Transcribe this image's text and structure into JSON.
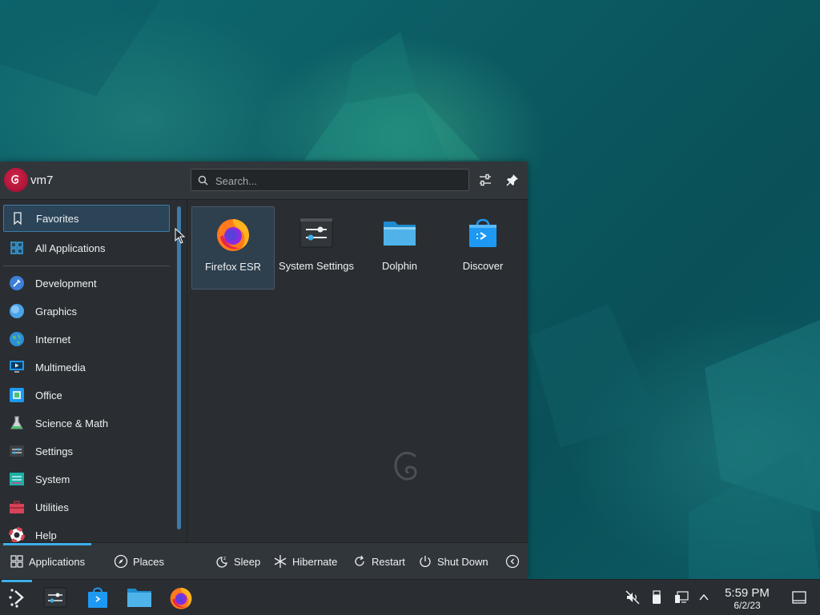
{
  "user": {
    "name": "vm7"
  },
  "search": {
    "placeholder": "Search..."
  },
  "sidebar": {
    "items": [
      {
        "label": "Favorites",
        "icon": "bookmark-icon"
      },
      {
        "label": "All Applications",
        "icon": "grid-icon"
      },
      {
        "label": "Development",
        "icon": "development-icon"
      },
      {
        "label": "Graphics",
        "icon": "graphics-icon"
      },
      {
        "label": "Internet",
        "icon": "globe-icon"
      },
      {
        "label": "Multimedia",
        "icon": "multimedia-icon"
      },
      {
        "label": "Office",
        "icon": "office-icon"
      },
      {
        "label": "Science & Math",
        "icon": "flask-icon"
      },
      {
        "label": "Settings",
        "icon": "settings-icon"
      },
      {
        "label": "System",
        "icon": "system-icon"
      },
      {
        "label": "Utilities",
        "icon": "toolbox-icon"
      },
      {
        "label": "Help",
        "icon": "lifebuoy-icon"
      }
    ]
  },
  "favorites": [
    {
      "label": "Firefox ESR",
      "icon": "firefox-icon"
    },
    {
      "label": "System Settings",
      "icon": "system-settings-icon"
    },
    {
      "label": "Dolphin",
      "icon": "folder-icon"
    },
    {
      "label": "Discover",
      "icon": "discover-bag-icon"
    }
  ],
  "footer": {
    "applications": "Applications",
    "places": "Places",
    "sleep": "Sleep",
    "hibernate": "Hibernate",
    "restart": "Restart",
    "shutdown": "Shut Down"
  },
  "clock": {
    "time": "5:59 PM",
    "date": "6/2/23"
  },
  "colors": {
    "accent": "#3daee9",
    "panel": "#2a2e32",
    "desktop": "#0d5f66"
  }
}
